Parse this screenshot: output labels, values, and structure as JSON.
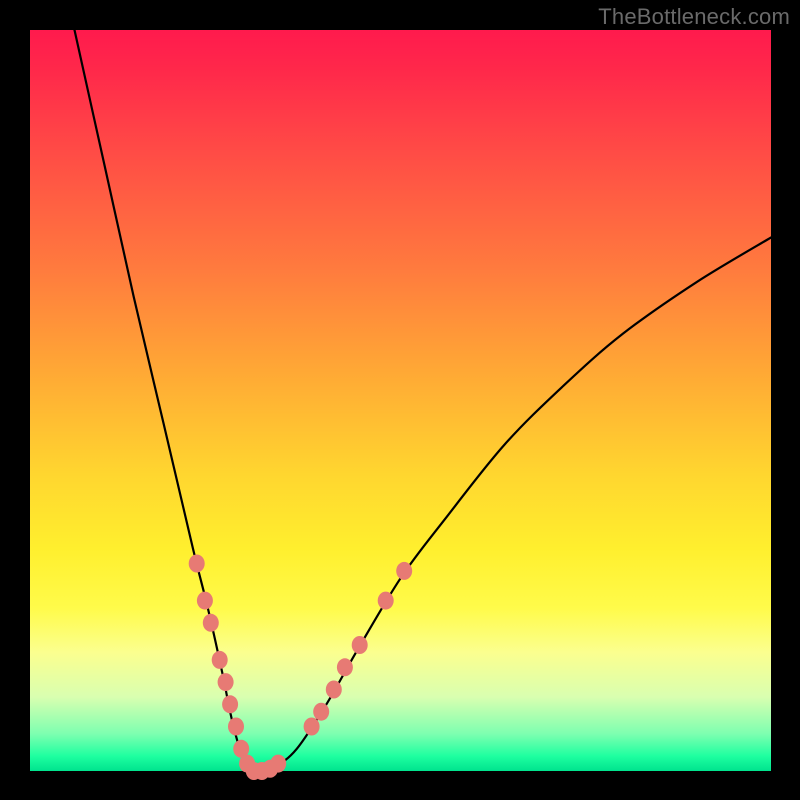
{
  "watermark": "TheBottleneck.com",
  "chart_data": {
    "type": "line",
    "title": "",
    "xlabel": "",
    "ylabel": "",
    "xlim": [
      0,
      100
    ],
    "ylim": [
      0,
      100
    ],
    "grid": false,
    "legend": false,
    "series": [
      {
        "name": "bottleneck-curve",
        "x": [
          6,
          10,
          14,
          18,
          22,
          24,
          26,
          27,
          28,
          29,
          30,
          31,
          33,
          36,
          40,
          44,
          50,
          56,
          64,
          72,
          80,
          90,
          100
        ],
        "values": [
          100,
          82,
          64,
          47,
          30,
          22,
          13,
          8,
          4,
          1,
          0,
          0,
          0.5,
          3,
          9,
          16,
          26,
          34,
          44,
          52,
          59,
          66,
          72
        ]
      }
    ],
    "markers": {
      "name": "highlight-points",
      "color": "#e77a74",
      "points": [
        {
          "x": 22.5,
          "y": 28
        },
        {
          "x": 23.6,
          "y": 23
        },
        {
          "x": 24.4,
          "y": 20
        },
        {
          "x": 25.6,
          "y": 15
        },
        {
          "x": 26.4,
          "y": 12
        },
        {
          "x": 27.0,
          "y": 9
        },
        {
          "x": 27.8,
          "y": 6
        },
        {
          "x": 28.5,
          "y": 3
        },
        {
          "x": 29.3,
          "y": 1
        },
        {
          "x": 30.2,
          "y": 0
        },
        {
          "x": 31.3,
          "y": 0
        },
        {
          "x": 32.4,
          "y": 0.3
        },
        {
          "x": 33.5,
          "y": 1
        },
        {
          "x": 38.0,
          "y": 6
        },
        {
          "x": 39.3,
          "y": 8
        },
        {
          "x": 41.0,
          "y": 11
        },
        {
          "x": 42.5,
          "y": 14
        },
        {
          "x": 44.5,
          "y": 17
        },
        {
          "x": 48.0,
          "y": 23
        },
        {
          "x": 50.5,
          "y": 27
        }
      ]
    }
  }
}
